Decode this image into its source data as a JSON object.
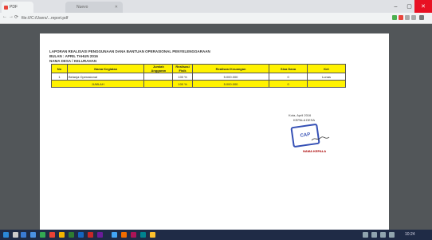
{
  "browser": {
    "active_tab": "PDF",
    "inactive_tab": "Nuevo",
    "address": "file:///C:/Users/...report.pdf"
  },
  "document": {
    "heading_line1": "LAPORAN REALISASI PENGGUNAAN DANA BANTUAN OPERASIONAL PENYELENGGARAAN",
    "heading_line2": "BULAN : APRIL TAHUN 2016",
    "heading_line3": "NAMA DESA / KELURAHAN",
    "table": {
      "headers": [
        "No",
        "Nama Kegiatan",
        "Jumlah Anggaran",
        "Realisasi Fisik",
        "Realisasi Keuangan",
        "Sisa Dana",
        "Ket"
      ],
      "rows": [
        [
          "1",
          "Belanja Operasional",
          "",
          "100 %",
          "5.000.000",
          "0",
          "Lunas"
        ]
      ],
      "total": [
        "JUMLAH",
        "",
        "100 %",
        "5.000.000",
        "0",
        ""
      ]
    },
    "signature": {
      "place_date": "Kota, April 2016",
      "role": "KEPALA DESA",
      "stamp_text": "CAP",
      "name": "NAMA KEPALA"
    }
  },
  "taskbar": {
    "time": "10:24"
  }
}
